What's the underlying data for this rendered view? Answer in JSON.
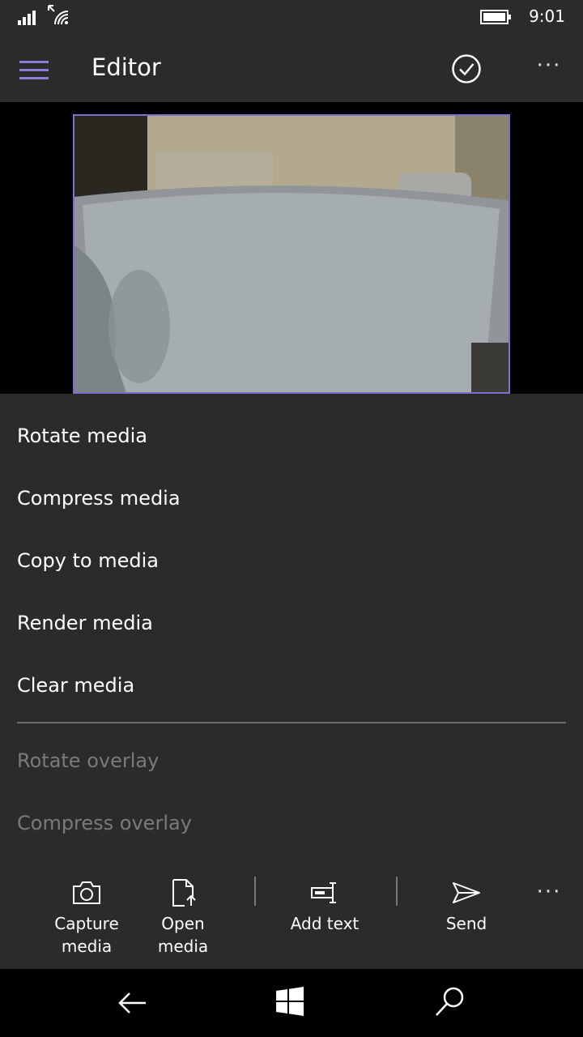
{
  "status": {
    "time": "9:01",
    "signal_icon": "signal-bars-icon",
    "wifi_icon": "wifi-icon",
    "battery_icon": "battery-icon"
  },
  "appbar": {
    "title": "Editor",
    "menu_icon": "hamburger-menu-icon",
    "accept_icon": "checkmark-circle-icon",
    "more_label": "···"
  },
  "canvas": {
    "image": "photo of white mug"
  },
  "menu": {
    "items": [
      {
        "label": "Rotate media",
        "enabled": true
      },
      {
        "label": "Compress media",
        "enabled": true
      },
      {
        "label": "Copy to media",
        "enabled": true
      },
      {
        "label": "Render media",
        "enabled": true
      },
      {
        "label": "Clear media",
        "enabled": true
      },
      {
        "label": "Rotate overlay",
        "enabled": false
      },
      {
        "label": "Compress overlay",
        "enabled": false
      }
    ]
  },
  "commandbar": {
    "capture_line1": "Capture",
    "capture_line2": "media",
    "open_media": "Open media",
    "add_text": "Add text",
    "send": "Send",
    "more_label": "···"
  },
  "navbar": {
    "back_icon": "back-arrow-icon",
    "windows_icon": "windows-logo-icon",
    "search_icon": "search-icon"
  },
  "colors": {
    "accent": "#7b70cf",
    "chrome": "#2b2b2b",
    "disabled_text": "#7a7a7a"
  }
}
